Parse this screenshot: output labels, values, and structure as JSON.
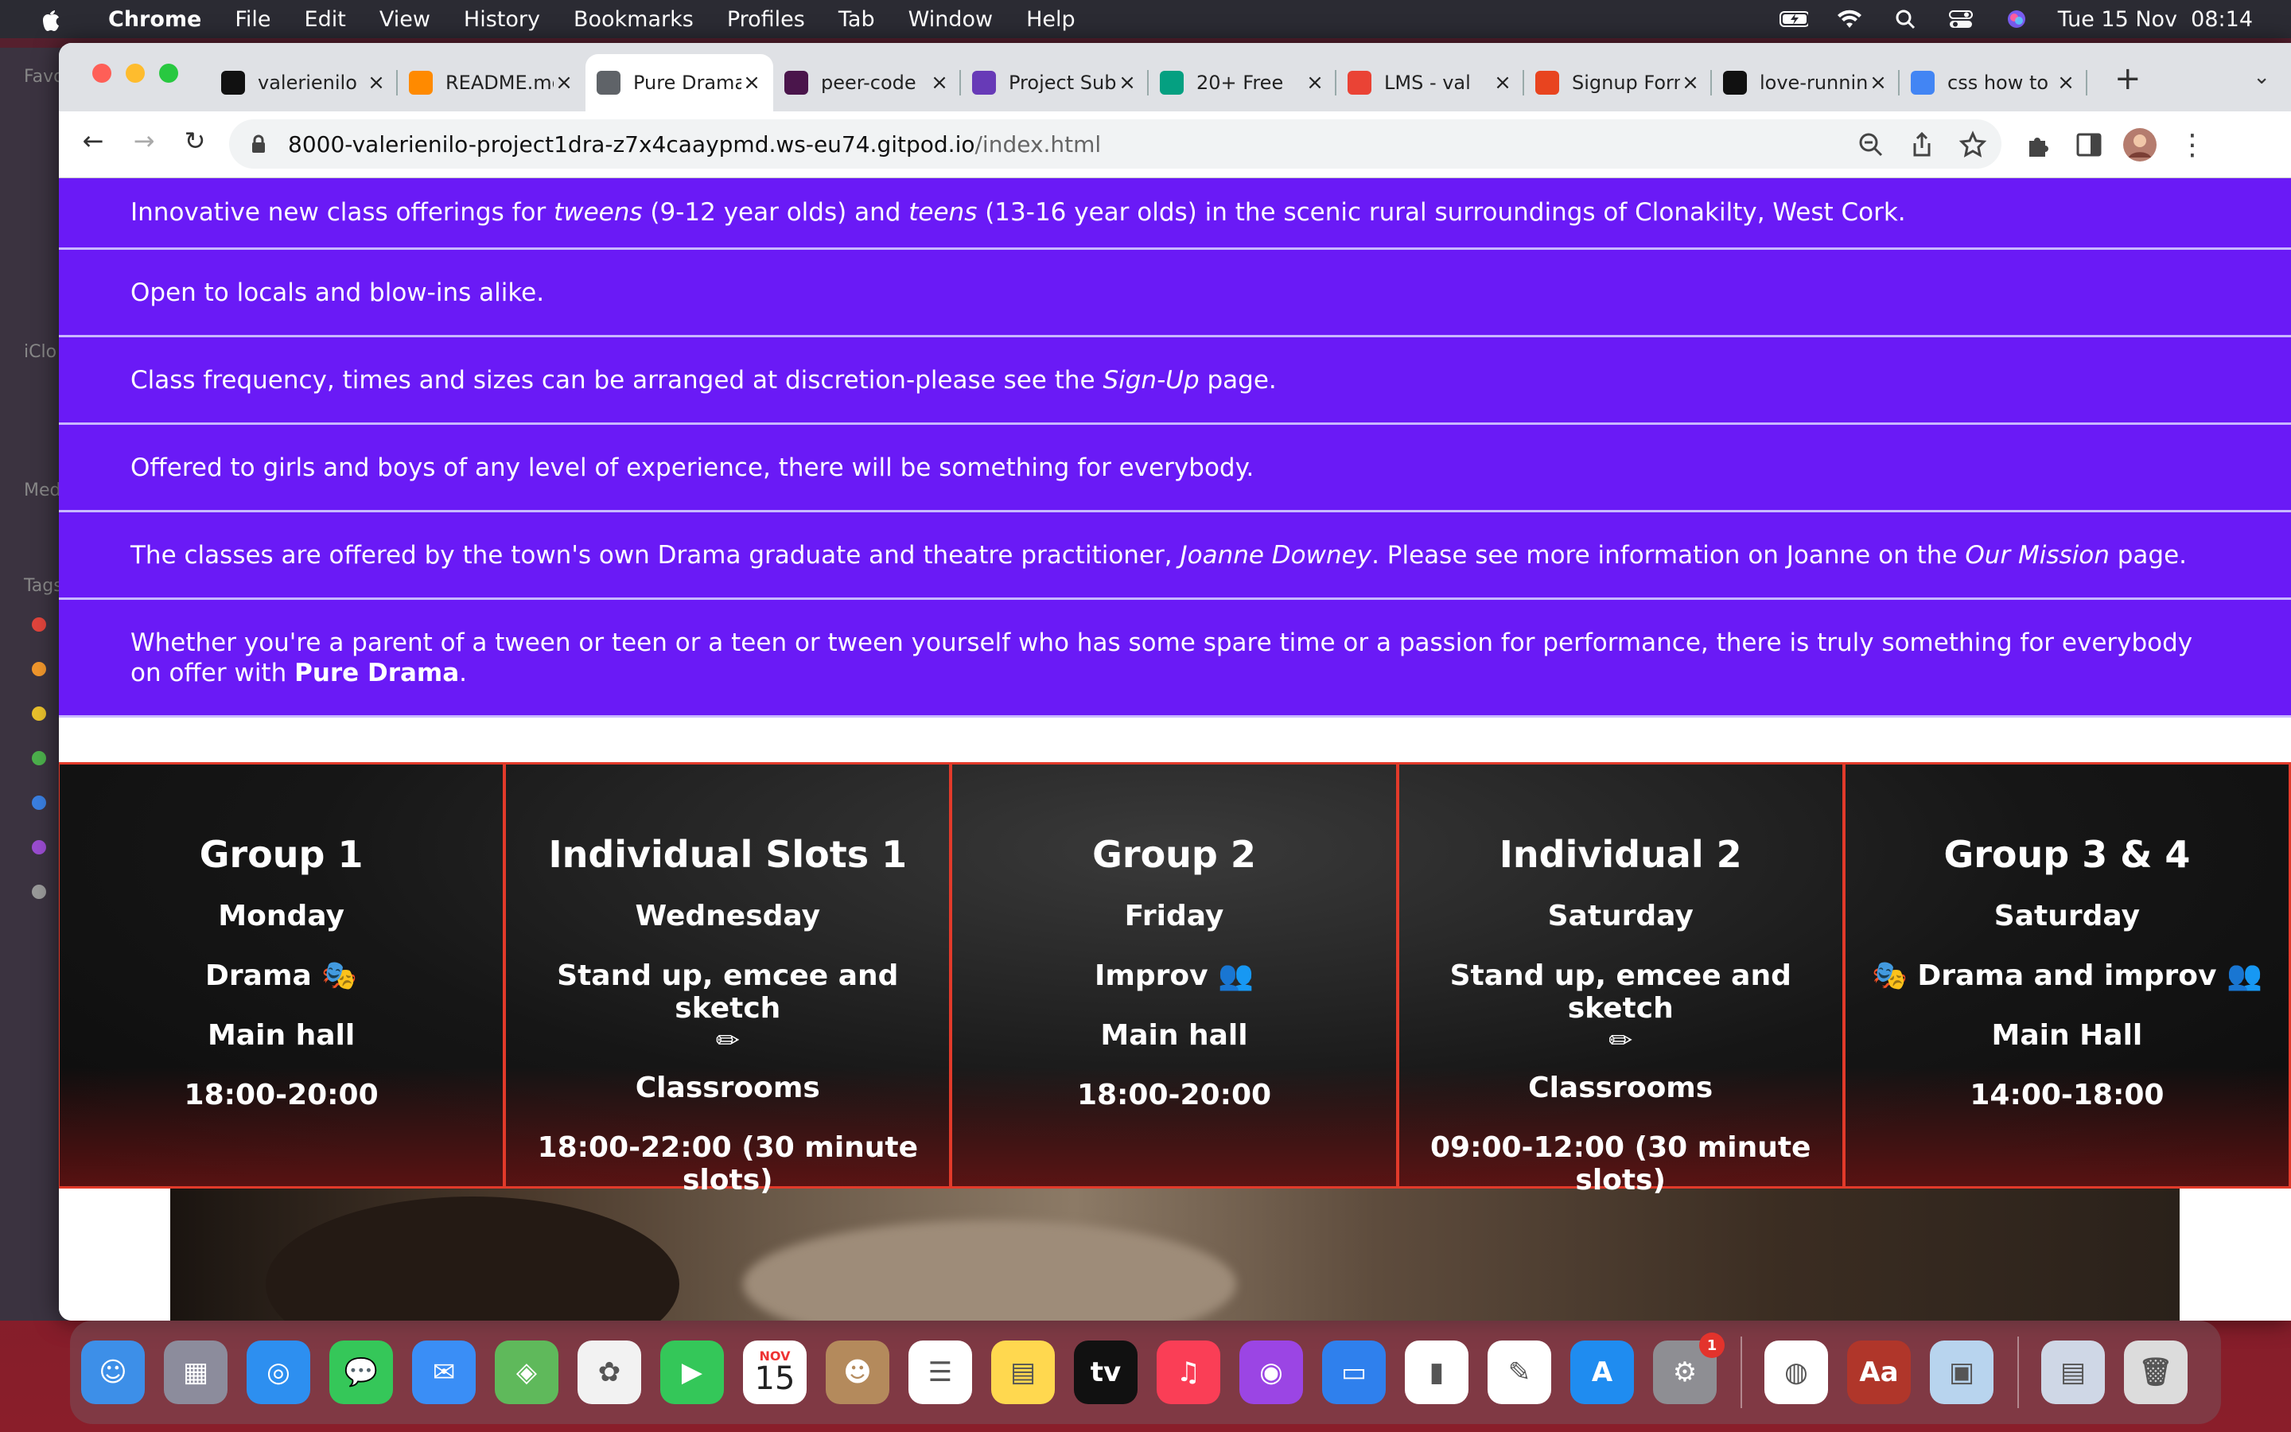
{
  "menubar": {
    "app": "Chrome",
    "items": [
      "File",
      "Edit",
      "View",
      "History",
      "Bookmarks",
      "Profiles",
      "Tab",
      "Window",
      "Help"
    ],
    "clock": "Tue 15 Nov  08:14"
  },
  "finder_sidebar": {
    "labels": [
      "Favo",
      "iClo",
      "Med",
      "Tags"
    ]
  },
  "tabs": [
    {
      "title": "valerienilo",
      "favicon": "github-icon",
      "color": "#111111"
    },
    {
      "title": "README.md",
      "favicon": "gitpod-icon",
      "color": "#ff8a00"
    },
    {
      "title": "Pure Drama",
      "favicon": "globe-icon",
      "color": "#5f6368"
    },
    {
      "title": "peer-code",
      "favicon": "slack-icon",
      "color": "#4a154b"
    },
    {
      "title": "Project Sub",
      "favicon": "form-icon",
      "color": "#673ab7"
    },
    {
      "title": "20+ Free",
      "favicon": "pexels-icon",
      "color": "#05a081"
    },
    {
      "title": "LMS - val",
      "favicon": "gmail-icon",
      "color": "#ea4335"
    },
    {
      "title": "Signup Form",
      "favicon": "circle-icon",
      "color": "#e8441f"
    },
    {
      "title": "love-running",
      "favicon": "github-icon",
      "color": "#111111"
    },
    {
      "title": "css how to",
      "favicon": "google-icon",
      "color": "#4285f4"
    }
  ],
  "address": {
    "host": "8000-valerienilo-project1dra-z7x4caaypmd.ws-eu74.gitpod.io",
    "path": "/index.html"
  },
  "features": [
    {
      "html": "Innovative new class offerings for <i>tweens</i> (9-12 year olds) and <i>teens</i> (13-16 year olds) in the scenic rural surroundings of Clonakilty, West Cork."
    },
    {
      "html": "Open to locals and blow-ins alike."
    },
    {
      "html": "Class frequency, times and sizes can be arranged at discretion-please see the <i>Sign-Up</i> page."
    },
    {
      "html": "Offered to girls and boys of any level of experience, there will be something for everybody."
    },
    {
      "html": "The classes are offered by the town's own Drama graduate and theatre practitioner, <i>Joanne Downey</i>. Please see more information on Joanne on the <i>Our Mission</i> page."
    },
    {
      "html": "Whether you're a parent of a tween or teen or a teen or tween yourself who has some spare time or a passion for performance, there is truly something for everybody on offer with <b>Pure Drama</b>."
    }
  ],
  "schedule": [
    {
      "title": "Group 1",
      "day": "Monday",
      "activity": "Drama",
      "icon_before": "",
      "icon_after": "🎭",
      "place": "Main hall",
      "time": "18:00-20:00"
    },
    {
      "title": "Individual Slots 1",
      "day": "Wednesday",
      "activity": "Stand up, emcee and sketch",
      "icon_before": "",
      "icon_after": "✏",
      "place": "Classrooms",
      "time": "18:00-22:00 (30 minute slots)"
    },
    {
      "title": "Group 2",
      "day": "Friday",
      "activity": "Improv",
      "icon_before": "",
      "icon_after": "👥",
      "place": "Main hall",
      "time": "18:00-20:00"
    },
    {
      "title": "Individual 2",
      "day": "Saturday",
      "activity": "Stand up, emcee and sketch",
      "icon_before": "",
      "icon_after": "✏",
      "place": "Classrooms",
      "time": "09:00-12:00 (30 minute slots)"
    },
    {
      "title": "Group 3 & 4",
      "day": "Saturday",
      "activity": "Drama and improv",
      "icon_before": "🎭",
      "icon_after": "👥",
      "place": "Main Hall",
      "time": "14:00-18:00"
    }
  ],
  "dock": [
    {
      "name": "finder-icon",
      "color": "#3d8fe8",
      "glyph": "☺"
    },
    {
      "name": "launchpad-icon",
      "color": "#8c8c9c",
      "glyph": "▦"
    },
    {
      "name": "safari-icon",
      "color": "#2d8ff0",
      "glyph": "◎"
    },
    {
      "name": "messages-icon",
      "color": "#35c759",
      "glyph": "💬"
    },
    {
      "name": "mail-icon",
      "color": "#3a8ef6",
      "glyph": "✉"
    },
    {
      "name": "maps-icon",
      "color": "#5fb95b",
      "glyph": "◈"
    },
    {
      "name": "photos-icon",
      "color": "#f2f2f2",
      "glyph": "✿"
    },
    {
      "name": "facetime-icon",
      "color": "#34c759",
      "glyph": "▶"
    },
    {
      "name": "calendar-icon",
      "color": "#ffffff",
      "glyph": "15"
    },
    {
      "name": "contacts-icon",
      "color": "#b48a5c",
      "glyph": "☻"
    },
    {
      "name": "reminders-icon",
      "color": "#ffffff",
      "glyph": "☰"
    },
    {
      "name": "notes-icon",
      "color": "#ffd84f",
      "glyph": "▤"
    },
    {
      "name": "appletv-icon",
      "color": "#111111",
      "glyph": "tv"
    },
    {
      "name": "music-icon",
      "color": "#fa3e56",
      "glyph": "♫"
    },
    {
      "name": "podcasts-icon",
      "color": "#9b45e4",
      "glyph": "◉"
    },
    {
      "name": "keynote-icon",
      "color": "#2f80ed",
      "glyph": "▭"
    },
    {
      "name": "numbers-icon",
      "color": "#ffffff",
      "glyph": "▮"
    },
    {
      "name": "pages-icon",
      "color": "#ffffff",
      "glyph": "✎"
    },
    {
      "name": "appstore-icon",
      "color": "#1f8cf0",
      "glyph": "A"
    },
    {
      "name": "system-preferences-icon",
      "color": "#8e8e93",
      "glyph": "⚙"
    },
    {
      "name": "chrome-icon",
      "color": "#ffffff",
      "glyph": "◍"
    },
    {
      "name": "dictionary-icon",
      "color": "#b0362a",
      "glyph": "Aa"
    },
    {
      "name": "preview-icon",
      "color": "#b8d4ee",
      "glyph": "▣"
    },
    {
      "name": "downloads-stack-icon",
      "color": "#cfd7e6",
      "glyph": "▤"
    },
    {
      "name": "trash-icon",
      "color": "#dcdcdc",
      "glyph": "🗑"
    }
  ],
  "calendar": {
    "month": "NOV",
    "day": "15"
  },
  "system_prefs_badge": "1"
}
